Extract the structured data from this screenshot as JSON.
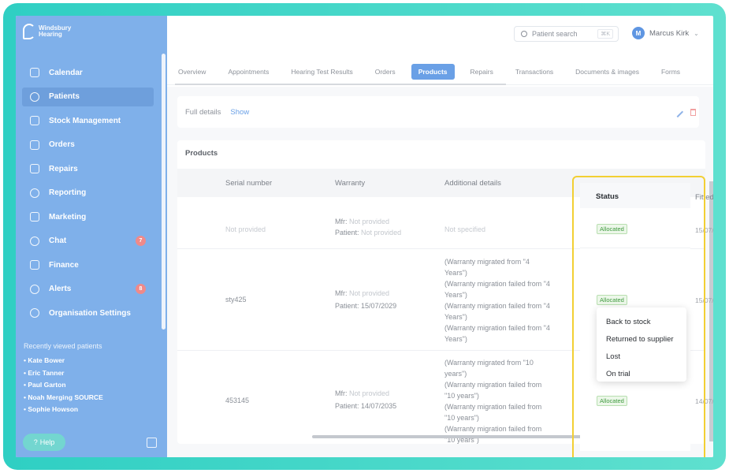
{
  "brand": {
    "name_line1": "Windsbury",
    "name_line2": "Hearing"
  },
  "sidebar": {
    "items": [
      {
        "label": "Calendar",
        "icon": "calendar-icon"
      },
      {
        "label": "Patients",
        "icon": "patients-icon",
        "active": true
      },
      {
        "label": "Stock Management",
        "icon": "stock-icon"
      },
      {
        "label": "Orders",
        "icon": "orders-icon"
      },
      {
        "label": "Repairs",
        "icon": "wrench-icon"
      },
      {
        "label": "Reporting",
        "icon": "chart-icon"
      },
      {
        "label": "Marketing",
        "icon": "mail-icon"
      },
      {
        "label": "Chat",
        "icon": "chat-icon",
        "badge": "7"
      },
      {
        "label": "Finance",
        "icon": "card-icon"
      },
      {
        "label": "Alerts",
        "icon": "bell-icon",
        "badge": "8"
      },
      {
        "label": "Organisation Settings",
        "icon": "gear-icon"
      }
    ],
    "recent_title": "Recently viewed patients",
    "recent": [
      "Kate Bower",
      "Eric Tanner",
      "Paul Garton",
      "Noah Merging SOURCE",
      "Sophie Howson"
    ],
    "help_label": "Help"
  },
  "header": {
    "search_placeholder": "Patient search",
    "search_shortcut": "⌘K",
    "user_initial": "M",
    "user_name": "Marcus Kirk"
  },
  "tabs": [
    "Overview",
    "Appointments",
    "Hearing Test Results",
    "Orders",
    "Products",
    "Repairs",
    "Transactions",
    "Documents & images",
    "Forms"
  ],
  "active_tab": "Products",
  "details": {
    "label": "Full details",
    "show": "Show"
  },
  "products": {
    "title": "Products",
    "columns": {
      "serial": "Serial number",
      "warranty": "Warranty",
      "additional": "Additional details",
      "status": "Status",
      "fitted": "Fitted"
    },
    "rows": [
      {
        "serial": "Not provided",
        "mfr_label": "Mfr:",
        "mfr": "Not provided",
        "patient_label": "Patient:",
        "patient": "Not provided",
        "additional": [
          "Not specified"
        ],
        "status": "Allocated",
        "fitted": "15/07/"
      },
      {
        "serial": "sty425",
        "mfr_label": "Mfr:",
        "mfr": "Not provided",
        "patient_label": "Patient:",
        "patient": "15/07/2029",
        "additional": [
          "(Warranty migrated from \"4",
          "Years\")",
          "(Warranty migration failed from \"4",
          "Years\")",
          "(Warranty migration failed from \"4",
          "Years\")",
          "(Warranty migration failed from \"4",
          "Years\")"
        ],
        "status": "Allocated",
        "fitted": "15/07/"
      },
      {
        "serial": "453145",
        "mfr_label": "Mfr:",
        "mfr": "Not provided",
        "patient_label": "Patient:",
        "patient": "14/07/2035",
        "additional": [
          "(Warranty migrated from \"10",
          "years\")",
          "(Warranty migration failed from",
          "\"10 years\")",
          "(Warranty migration failed from",
          "\"10 years\")",
          "(Warranty migration failed from",
          "\"10 years\")"
        ],
        "status": "Allocated",
        "fitted": "14/07/"
      }
    ]
  },
  "status_menu": [
    "Back to stock",
    "Returned to supplier",
    "Lost",
    "On trial"
  ],
  "colors": {
    "sidebar": "#7fb0ea",
    "accent": "#6aa0e6",
    "highlight": "#f2cf33",
    "frame": "#3fd8c8"
  }
}
